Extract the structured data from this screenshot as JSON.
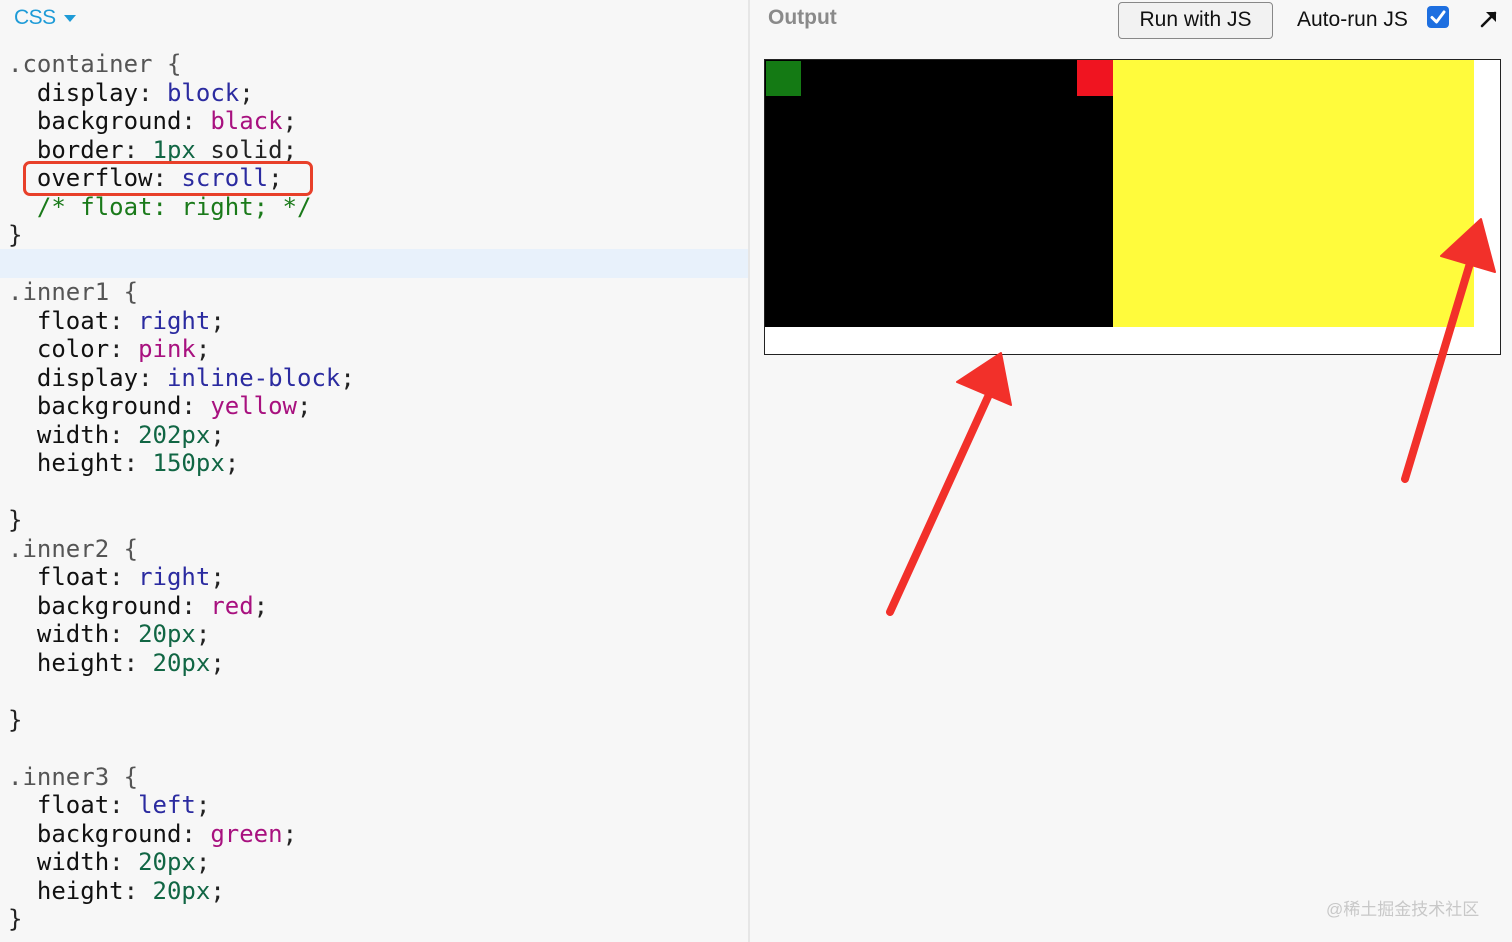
{
  "editor": {
    "language_tab": "CSS",
    "lines": [
      ".container {",
      "  display: block;",
      "  background: black;",
      "  border: 1px solid;",
      "  overflow: scroll;",
      "  /* float: right; */",
      "}",
      "",
      ".inner1 {",
      "  float: right;",
      "  color: pink;",
      "  display: inline-block;",
      "  background: yellow;",
      "  width: 202px;",
      "  height: 150px;",
      "",
      "}",
      ".inner2 {",
      "  float: right;",
      "  background: red;",
      "  width: 20px;",
      "  height: 20px;",
      "",
      "}",
      "",
      ".inner3 {",
      "  float: left;",
      "  background: green;",
      "  width: 20px;",
      "  height: 20px;",
      "}"
    ],
    "highlighted_line": "overflow: scroll;"
  },
  "output": {
    "label": "Output",
    "run_button_label": "Run with JS",
    "autorun_label": "Auto-run JS",
    "autorun_checked": true,
    "popout_icon": "popout-arrow-icon"
  },
  "preview_colors": {
    "container": "#000000",
    "inner1": "#fffb3c",
    "inner2": "#f01420",
    "inner3": "#147a14",
    "annotation_arrow": "#f2302a"
  },
  "watermark": "@稀土掘金技术社区"
}
